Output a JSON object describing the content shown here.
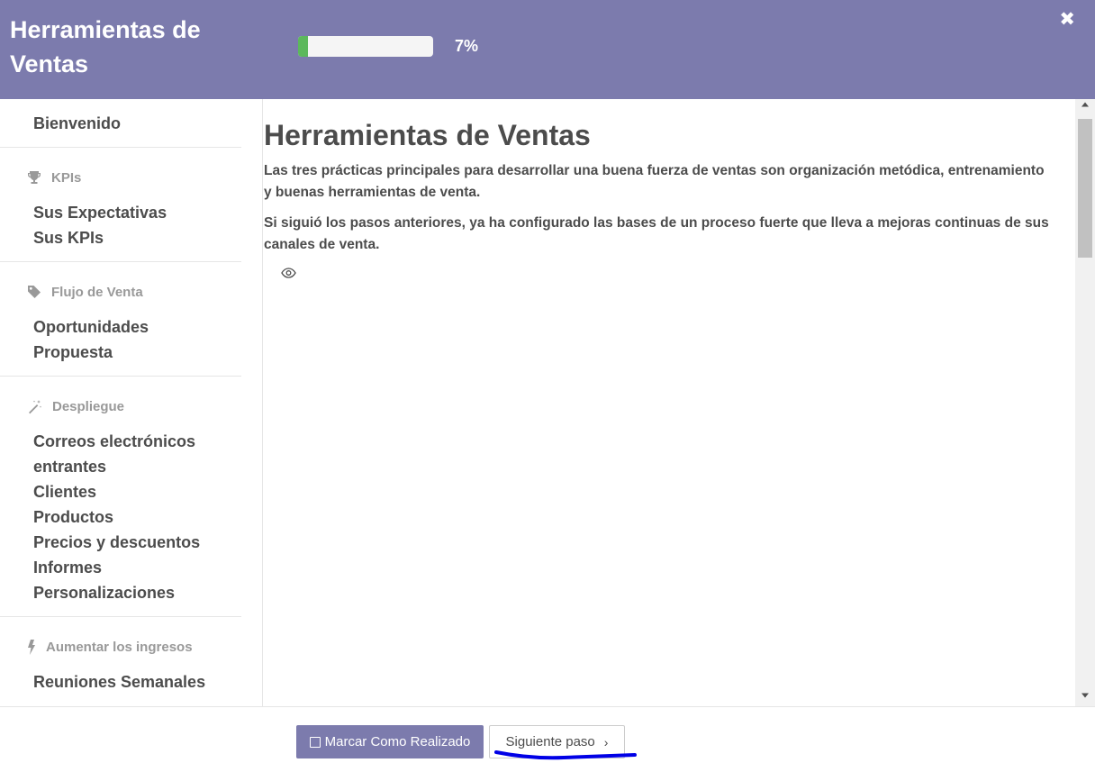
{
  "header": {
    "title": "Herramientas de Ventas",
    "progress": {
      "value": 7,
      "label": "7%"
    },
    "close_icon": "close-icon"
  },
  "sidebar": {
    "first_item": "Bienvenido",
    "sections": [
      {
        "icon": "trophy-icon",
        "title": "KPIs",
        "items": [
          "Sus Expectativas",
          "Sus KPIs"
        ]
      },
      {
        "icon": "tag-icon",
        "title": "Flujo de Venta",
        "items": [
          "Oportunidades",
          "Propuesta"
        ]
      },
      {
        "icon": "magic-wand-icon",
        "title": "Despliegue",
        "items": [
          "Correos electrónicos entrantes",
          "Clientes",
          "Productos",
          "Precios y descuentos",
          "Informes",
          "Personalizaciones"
        ]
      },
      {
        "icon": "lightning-icon",
        "title": "Aumentar los ingresos",
        "items": [
          "Reuniones Semanales"
        ]
      }
    ]
  },
  "content": {
    "title": "Herramientas de Ventas",
    "paragraphs": [
      "Las tres prácticas principales para desarrollar una buena fuerza de ventas son organización metódica, entrenamiento y buenas herramientas de venta.",
      "Si siguió los pasos anteriores, ya ha configurado las bases de un proceso fuerte que lleva a mejoras continuas de sus canales de venta."
    ],
    "icon": "eye-icon"
  },
  "footer": {
    "mark_done_label": "Marcar Como Realizado",
    "next_label": "Siguiente paso"
  },
  "colors": {
    "header_bg": "#7c7bad",
    "progress_fill": "#5cb85c",
    "annotation_blue": "#0000e6"
  }
}
